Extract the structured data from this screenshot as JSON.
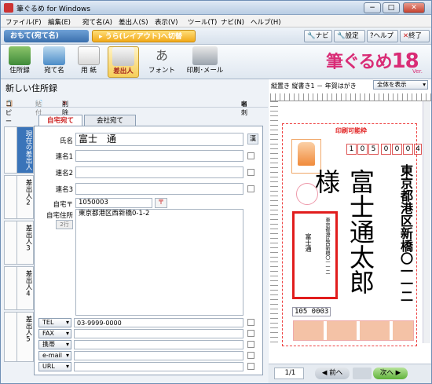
{
  "window": {
    "title": "筆ぐるめ for Windows",
    "min": "−",
    "max": "□",
    "close": "✕"
  },
  "menu": [
    "ファイル(F)",
    "編集(E)",
    "宛て名(A)",
    "差出人(S)",
    "表示(V)",
    "ツール(T)",
    "ナビ(N)",
    "ヘルプ(H)"
  ],
  "mode": {
    "front": "おもて(宛て名)",
    "back": "▸ うら(レイアウト)へ切替"
  },
  "top_buttons": {
    "navi": "ナビ",
    "settings": "設定",
    "help": "ヘルプ",
    "exit": "終了"
  },
  "tools": [
    "住所録",
    "宛て名",
    "用 紙",
    "差出人",
    "フォント",
    "印刷･メール"
  ],
  "logo": {
    "text": "筆ぐるめ",
    "num": "18",
    "ver": "Ver."
  },
  "panel": {
    "title": "新しい住所録"
  },
  "subtoolbar": {
    "copy": "コピー",
    "paste": "貼付",
    "delete": "削除",
    "name_label": "名刺"
  },
  "tabs": {
    "home": "自宅宛て",
    "company": "会社宛て"
  },
  "side_tabs": [
    "差出人6",
    "差出人7",
    "差出人8",
    "差出人9",
    "差出人10"
  ],
  "side_tabs2": [
    "現在の差出人",
    "差出人2",
    "差出人3",
    "差出人4",
    "差出人5"
  ],
  "form": {
    "name_label": "氏名",
    "name_value": "富士　通",
    "name_btn": "漢",
    "ren1": "連名1",
    "ren2": "連名2",
    "ren3": "連名3",
    "zip_label": "自宅〒",
    "zip_value": "1050003",
    "zip_btn": "〒",
    "addr_label": "自宅住所",
    "addr_value": "東京都港区西新橋0-1-2",
    "addr_btn": "2行"
  },
  "contacts": [
    {
      "label": "TEL",
      "value": "03-9999-0000"
    },
    {
      "label": "FAX",
      "value": ""
    },
    {
      "label": "携帯",
      "value": ""
    },
    {
      "label": "e-mail",
      "value": ""
    },
    {
      "label": "URL",
      "value": ""
    }
  ],
  "preview": {
    "header": "縦置き 縦書き1 － 年賀はがき",
    "select": "全体を表示",
    "printable": "印刷可能枠",
    "zip_digits": [
      "1",
      "0",
      "5",
      "0",
      "0",
      "0",
      "4"
    ],
    "addr": "東京都港区新橋〇一一二",
    "name": "富士通太郎様",
    "sender_addr": "東京都港区西新橋〇一一二",
    "sender_name": "富士通",
    "sender_zip": "105 0003",
    "page": "1/1",
    "prev": "前へ",
    "next": "次へ"
  },
  "colors": {
    "accent": "#d92c76",
    "mode_blue": "#3a6fad",
    "frame_red": "#e11d1d"
  }
}
